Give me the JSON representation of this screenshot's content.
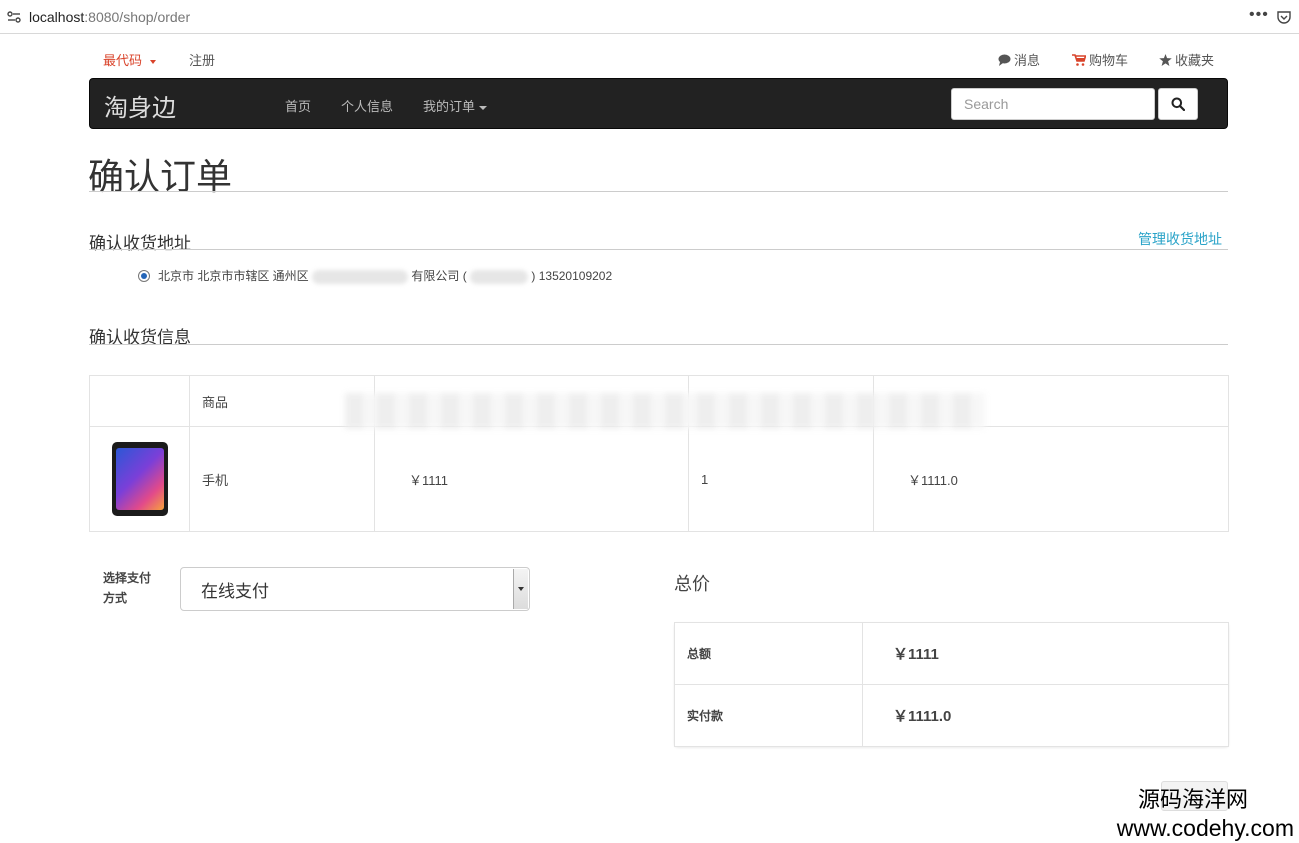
{
  "browser": {
    "url_host": "localhost",
    "url_rest": ":8080/shop/order",
    "more_label": "•••"
  },
  "topbar": {
    "brand_link": "最代码",
    "register": "注册",
    "messages": "消息",
    "cart": "购物车",
    "favorites": "收藏夹"
  },
  "navbar": {
    "brand": "淘身边",
    "items": [
      {
        "label": "首页"
      },
      {
        "label": "个人信息"
      },
      {
        "label": "我的订单"
      }
    ],
    "search_placeholder": "Search"
  },
  "page": {
    "title": "确认订单",
    "address_section": "确认收货地址",
    "manage_address": "管理收货地址",
    "address_prefix": "北京市 北京市市辖区 通州区",
    "address_company": "有限公司 (",
    "address_phone": ") 13520109202",
    "goods_section": "确认收货信息"
  },
  "goods_table": {
    "headers": [
      "",
      "商品",
      "",
      "",
      ""
    ],
    "rows": [
      {
        "name": "手机",
        "price": "￥1111",
        "qty": "1",
        "subtotal": "￥1111.0"
      }
    ]
  },
  "payment": {
    "label": "选择支付方式",
    "selected": "在线支付"
  },
  "totals": {
    "title": "总价",
    "rows": [
      {
        "label": "总额",
        "value": "￥1111"
      },
      {
        "label": "实付款",
        "value": "￥1111.0"
      }
    ]
  },
  "watermark": {
    "line1": "源码海洋网",
    "line2": "www.codehy.com"
  },
  "colors": {
    "accent_link": "#2aa3c8",
    "brand_red": "#d9432a",
    "navbar_bg": "#222222"
  }
}
